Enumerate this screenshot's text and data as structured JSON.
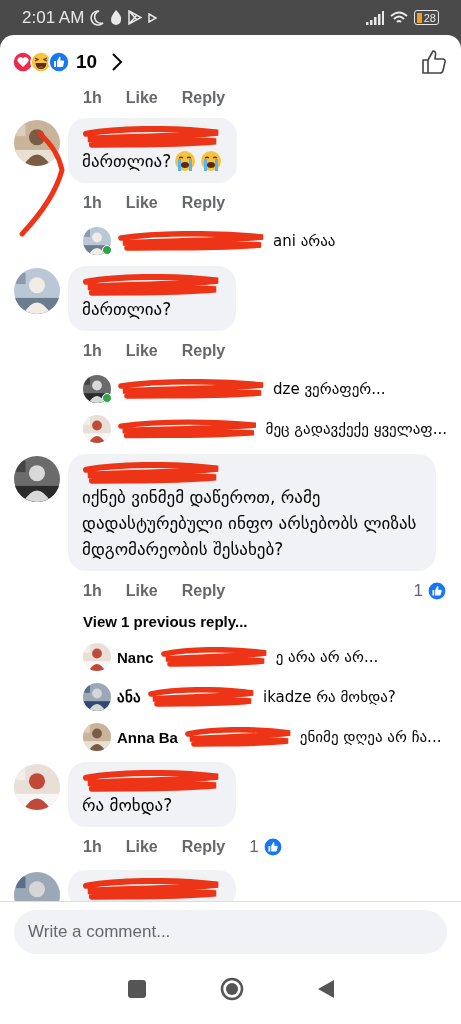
{
  "status_bar": {
    "time": "2:01 AM",
    "battery": "28"
  },
  "header": {
    "reactions": [
      {
        "kind": "love"
      },
      {
        "kind": "haha"
      },
      {
        "kind": "like"
      }
    ],
    "count": "10"
  },
  "top_actions": {
    "time": "1h",
    "like": "Like",
    "reply": "Reply"
  },
  "comments": [
    {
      "text": "მართლია?",
      "emojis": [
        {
          "kind": "crying"
        },
        {
          "kind": "crying"
        }
      ],
      "time": "1h",
      "like": "Like",
      "reply": "Reply",
      "marked": true,
      "replies": [
        {
          "text": "ani არაა",
          "online": true
        }
      ]
    },
    {
      "text": "მართლია?",
      "time": "1h",
      "like": "Like",
      "reply": "Reply",
      "marked": false,
      "replies": [
        {
          "text": "dze ვერაფერ...",
          "online": true
        },
        {
          "text": "მეც გადავქექე ყველაფ...",
          "online": false
        }
      ]
    },
    {
      "text": "იქნებ ვინმემ დაწეროთ, რამე დადასტურებული ინფო არსებობს ლიზას მდგომარეობის შესახებ?",
      "time": "1h",
      "like": "Like",
      "reply": "Reply",
      "likes": "1",
      "marked": false,
      "view_more": "View 1 previous reply...",
      "replies": [
        {
          "name": "Nanc",
          "text": "ე არა არ არ...",
          "online": false
        },
        {
          "name": "ანა",
          "text": "ikadze რა მოხდა?",
          "online": false
        },
        {
          "name": "Anna Ba",
          "text": "ენიმე დღეა არ ჩა...",
          "online": false
        }
      ]
    },
    {
      "text": "რა მოხდა?",
      "time": "1h",
      "like": "Like",
      "reply": "Reply",
      "likes": "1",
      "marked": false
    },
    {
      "marked": false
    }
  ],
  "composer": {
    "placeholder": "Write a comment..."
  }
}
